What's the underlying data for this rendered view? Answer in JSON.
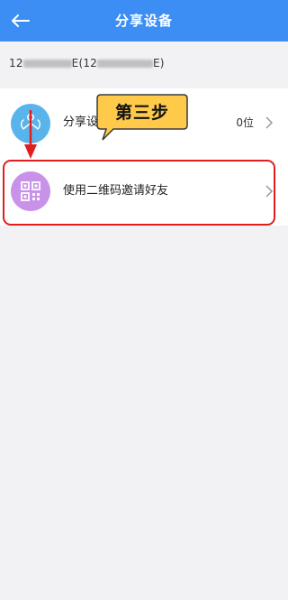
{
  "header": {
    "title": "分享设备",
    "back_icon": "back-arrow-icon",
    "background": "#3c8ef5"
  },
  "device": {
    "prefix": "12",
    "suffix_a": "E(12",
    "suffix_b": "E)"
  },
  "rows": [
    {
      "label": "分享设",
      "count": "0位",
      "icon": "share-people-icon"
    },
    {
      "label": "使用二维码邀请好友",
      "icon": "qr-code-icon"
    }
  ],
  "callout": {
    "text": "第三步",
    "color": "#ffc94a"
  },
  "annotation": {
    "highlight_color": "#e01e1e"
  }
}
